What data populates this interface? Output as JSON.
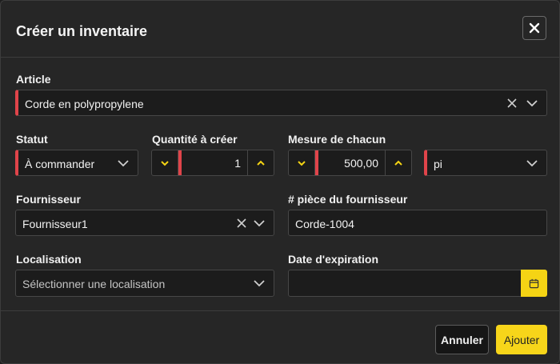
{
  "dialog": {
    "title": "Créer un inventaire",
    "close_label": "×"
  },
  "article": {
    "label": "Article",
    "value": "Corde en polypropylene"
  },
  "statut": {
    "label": "Statut",
    "value": "À commander"
  },
  "quantite": {
    "label": "Quantité à créer",
    "value": "1"
  },
  "mesure": {
    "label": "Mesure de chacun",
    "value": "500,00",
    "unit": "pi"
  },
  "fournisseur": {
    "label": "Fournisseur",
    "value": "Fournisseur1"
  },
  "piece": {
    "label": "# pièce du fournisseur",
    "value": "Corde-1004"
  },
  "localisation": {
    "label": "Localisation",
    "placeholder": "Sélectionner une localisation"
  },
  "expiration": {
    "label": "Date d'expiration",
    "value": ""
  },
  "footer": {
    "cancel_label": "Annuler",
    "add_label": "Ajouter"
  },
  "colors": {
    "accent": "#f7d51a",
    "required": "#e0444a",
    "background": "#262626"
  },
  "icons": [
    "close-icon",
    "clear-icon",
    "chevron-down-icon",
    "chevron-up-icon",
    "calendar-icon"
  ]
}
